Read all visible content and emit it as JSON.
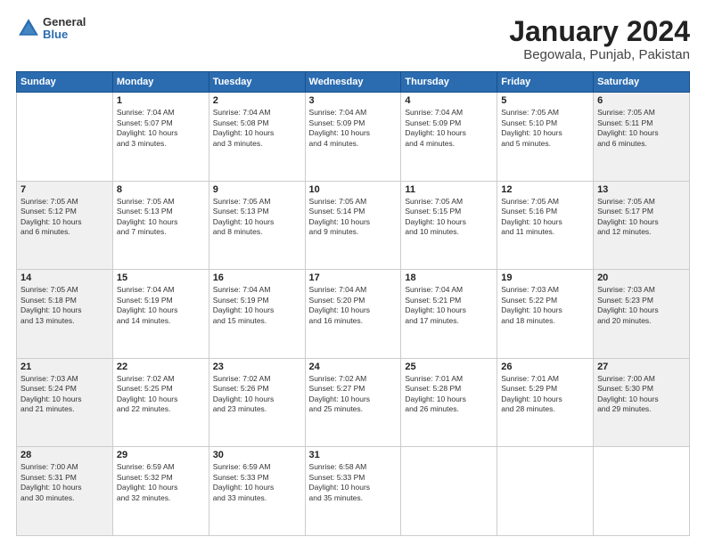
{
  "header": {
    "logo_general": "General",
    "logo_blue": "Blue",
    "title": "January 2024",
    "subtitle": "Begowala, Punjab, Pakistan"
  },
  "weekdays": [
    "Sunday",
    "Monday",
    "Tuesday",
    "Wednesday",
    "Thursday",
    "Friday",
    "Saturday"
  ],
  "weeks": [
    [
      {
        "day": "",
        "info": ""
      },
      {
        "day": "1",
        "info": "Sunrise: 7:04 AM\nSunset: 5:07 PM\nDaylight: 10 hours\nand 3 minutes."
      },
      {
        "day": "2",
        "info": "Sunrise: 7:04 AM\nSunset: 5:08 PM\nDaylight: 10 hours\nand 3 minutes."
      },
      {
        "day": "3",
        "info": "Sunrise: 7:04 AM\nSunset: 5:09 PM\nDaylight: 10 hours\nand 4 minutes."
      },
      {
        "day": "4",
        "info": "Sunrise: 7:04 AM\nSunset: 5:09 PM\nDaylight: 10 hours\nand 4 minutes."
      },
      {
        "day": "5",
        "info": "Sunrise: 7:05 AM\nSunset: 5:10 PM\nDaylight: 10 hours\nand 5 minutes."
      },
      {
        "day": "6",
        "info": "Sunrise: 7:05 AM\nSunset: 5:11 PM\nDaylight: 10 hours\nand 6 minutes."
      }
    ],
    [
      {
        "day": "7",
        "info": "Sunrise: 7:05 AM\nSunset: 5:12 PM\nDaylight: 10 hours\nand 6 minutes."
      },
      {
        "day": "8",
        "info": "Sunrise: 7:05 AM\nSunset: 5:13 PM\nDaylight: 10 hours\nand 7 minutes."
      },
      {
        "day": "9",
        "info": "Sunrise: 7:05 AM\nSunset: 5:13 PM\nDaylight: 10 hours\nand 8 minutes."
      },
      {
        "day": "10",
        "info": "Sunrise: 7:05 AM\nSunset: 5:14 PM\nDaylight: 10 hours\nand 9 minutes."
      },
      {
        "day": "11",
        "info": "Sunrise: 7:05 AM\nSunset: 5:15 PM\nDaylight: 10 hours\nand 10 minutes."
      },
      {
        "day": "12",
        "info": "Sunrise: 7:05 AM\nSunset: 5:16 PM\nDaylight: 10 hours\nand 11 minutes."
      },
      {
        "day": "13",
        "info": "Sunrise: 7:05 AM\nSunset: 5:17 PM\nDaylight: 10 hours\nand 12 minutes."
      }
    ],
    [
      {
        "day": "14",
        "info": "Sunrise: 7:05 AM\nSunset: 5:18 PM\nDaylight: 10 hours\nand 13 minutes."
      },
      {
        "day": "15",
        "info": "Sunrise: 7:04 AM\nSunset: 5:19 PM\nDaylight: 10 hours\nand 14 minutes."
      },
      {
        "day": "16",
        "info": "Sunrise: 7:04 AM\nSunset: 5:19 PM\nDaylight: 10 hours\nand 15 minutes."
      },
      {
        "day": "17",
        "info": "Sunrise: 7:04 AM\nSunset: 5:20 PM\nDaylight: 10 hours\nand 16 minutes."
      },
      {
        "day": "18",
        "info": "Sunrise: 7:04 AM\nSunset: 5:21 PM\nDaylight: 10 hours\nand 17 minutes."
      },
      {
        "day": "19",
        "info": "Sunrise: 7:03 AM\nSunset: 5:22 PM\nDaylight: 10 hours\nand 18 minutes."
      },
      {
        "day": "20",
        "info": "Sunrise: 7:03 AM\nSunset: 5:23 PM\nDaylight: 10 hours\nand 20 minutes."
      }
    ],
    [
      {
        "day": "21",
        "info": "Sunrise: 7:03 AM\nSunset: 5:24 PM\nDaylight: 10 hours\nand 21 minutes."
      },
      {
        "day": "22",
        "info": "Sunrise: 7:02 AM\nSunset: 5:25 PM\nDaylight: 10 hours\nand 22 minutes."
      },
      {
        "day": "23",
        "info": "Sunrise: 7:02 AM\nSunset: 5:26 PM\nDaylight: 10 hours\nand 23 minutes."
      },
      {
        "day": "24",
        "info": "Sunrise: 7:02 AM\nSunset: 5:27 PM\nDaylight: 10 hours\nand 25 minutes."
      },
      {
        "day": "25",
        "info": "Sunrise: 7:01 AM\nSunset: 5:28 PM\nDaylight: 10 hours\nand 26 minutes."
      },
      {
        "day": "26",
        "info": "Sunrise: 7:01 AM\nSunset: 5:29 PM\nDaylight: 10 hours\nand 28 minutes."
      },
      {
        "day": "27",
        "info": "Sunrise: 7:00 AM\nSunset: 5:30 PM\nDaylight: 10 hours\nand 29 minutes."
      }
    ],
    [
      {
        "day": "28",
        "info": "Sunrise: 7:00 AM\nSunset: 5:31 PM\nDaylight: 10 hours\nand 30 minutes."
      },
      {
        "day": "29",
        "info": "Sunrise: 6:59 AM\nSunset: 5:32 PM\nDaylight: 10 hours\nand 32 minutes."
      },
      {
        "day": "30",
        "info": "Sunrise: 6:59 AM\nSunset: 5:33 PM\nDaylight: 10 hours\nand 33 minutes."
      },
      {
        "day": "31",
        "info": "Sunrise: 6:58 AM\nSunset: 5:33 PM\nDaylight: 10 hours\nand 35 minutes."
      },
      {
        "day": "",
        "info": ""
      },
      {
        "day": "",
        "info": ""
      },
      {
        "day": "",
        "info": ""
      }
    ]
  ]
}
